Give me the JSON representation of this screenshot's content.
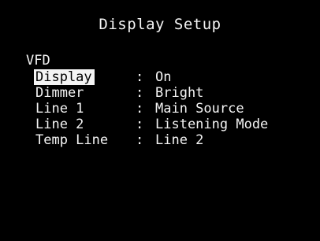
{
  "screen": {
    "title": "Display Setup",
    "section": "VFD"
  },
  "menu": {
    "selected_index": 0,
    "items": [
      {
        "label": "Display",
        "value": "On"
      },
      {
        "label": "Dimmer",
        "value": "Bright"
      },
      {
        "label": "Line 1",
        "value": "Main Source"
      },
      {
        "label": "Line 2",
        "value": "Listening Mode"
      },
      {
        "label": "Temp Line",
        "value": "Line 2"
      }
    ],
    "separator": ":"
  },
  "colors": {
    "background": "#000000",
    "text": "#f4f4f4",
    "highlight_bg": "#f4f4f4",
    "highlight_text": "#000000"
  }
}
